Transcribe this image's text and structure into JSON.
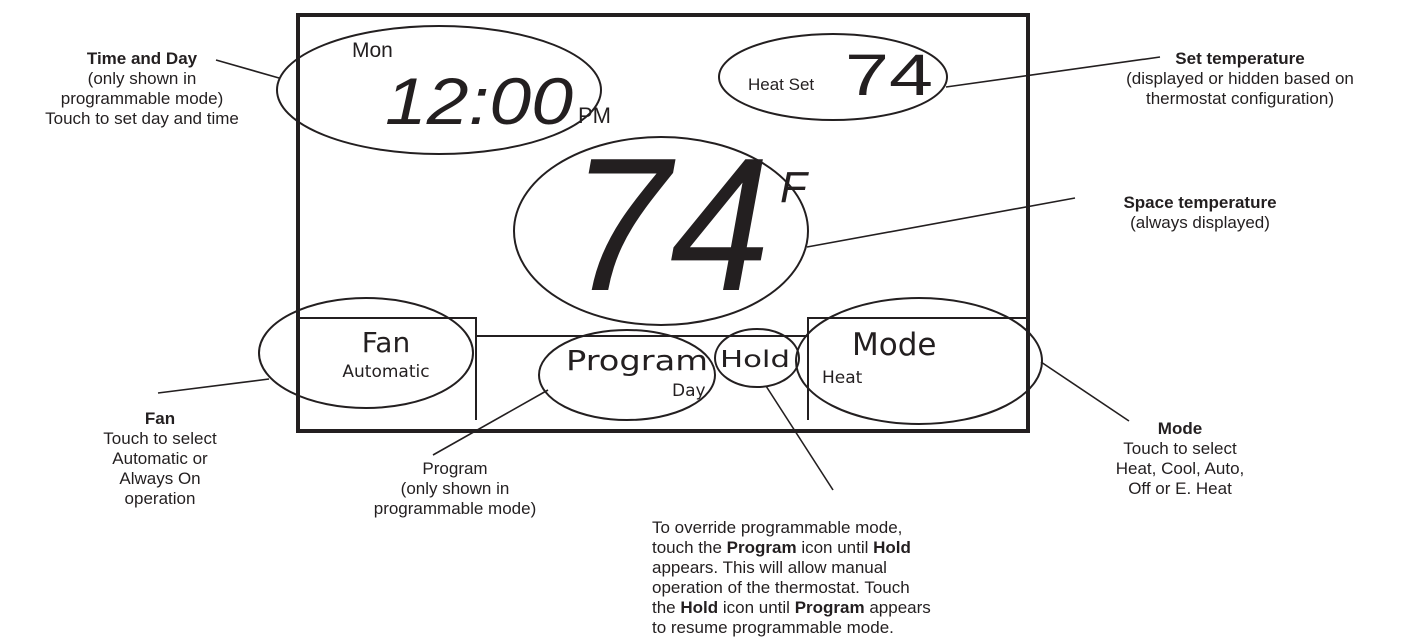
{
  "colors": {
    "ink": "#231f20",
    "background": "#ffffff"
  },
  "display": {
    "day": "Mon",
    "time": "12:00",
    "ampm": "PM",
    "set_label": "Heat Set",
    "set_temp": "74",
    "space_temp": "74",
    "unit": "F",
    "fan_label": "Fan",
    "fan_value": "Automatic",
    "program_label": "Program",
    "program_sub": "Day",
    "hold_label": "Hold",
    "mode_label": "Mode",
    "mode_value": "Heat"
  },
  "annotations": {
    "time_day": {
      "title": "Time and Day",
      "lines": [
        "(only shown in",
        "programmable mode)",
        "Touch to set day and time"
      ]
    },
    "set_temp": {
      "title": "Set temperature",
      "lines": [
        "(displayed or hidden based on",
        "thermostat configuration)"
      ]
    },
    "space_temp": {
      "title": "Space temperature",
      "lines": [
        "(always displayed)"
      ]
    },
    "fan": {
      "title": "Fan",
      "lines": [
        "Touch to select",
        "Automatic or",
        "Always On",
        "operation"
      ]
    },
    "program": {
      "lines": [
        "Program",
        "(only shown in",
        "programmable mode)"
      ]
    },
    "mode": {
      "title": "Mode",
      "lines": [
        "Touch to select",
        "Heat, Cool, Auto,",
        "Off or E. Heat"
      ]
    },
    "hold": {
      "line1": "To override programmable mode,",
      "line2_pre": "touch the ",
      "line2_b1": "Program",
      "line2_mid": " icon until ",
      "line2_b2": "Hold",
      "line3": "appears. This will allow manual",
      "line4": "operation of the thermostat. Touch",
      "line5_pre": "the ",
      "line5_b1": "Hold",
      "line5_mid": " icon until ",
      "line5_b2": "Program",
      "line5_post": " appears",
      "line6": "to resume programmable mode."
    }
  }
}
